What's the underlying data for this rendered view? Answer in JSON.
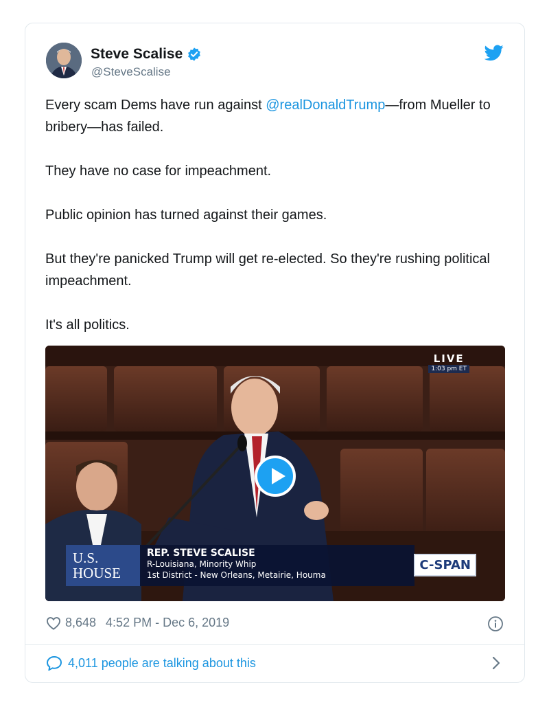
{
  "tweet": {
    "author_name": "Steve Scalise",
    "author_handle": "@SteveScalise",
    "paragraphs": [
      {
        "before": "Every scam Dems have run against ",
        "mention": "@realDonaldTrump",
        "after": "—from Mueller to bribery—has failed."
      },
      {
        "text": "They have no case for impeachment."
      },
      {
        "text": "Public opinion has turned against their games."
      },
      {
        "text": "But they're panicked Trump will get re-elected. So they're rushing political impeachment."
      },
      {
        "text": "It's all politics."
      }
    ],
    "likes": "8,648",
    "timestamp": "4:52 PM - Dec 6, 2019",
    "talking": "4,011 people are talking about this"
  },
  "video": {
    "live_label": "LIVE",
    "live_time": "1:03 pm ET",
    "house_logo_line1": "U.S.",
    "house_logo_line2": "HOUSE",
    "caption_name": "REP. STEVE SCALISE",
    "caption_line1": "R-Louisiana, Minority Whip",
    "caption_line2": "1st District - New Orleans, Metairie, Houma",
    "network": "C-SPAN"
  },
  "colors": {
    "link": "#1b95e0",
    "secondary_text": "#657786",
    "verified": "#1da1f2",
    "border": "#e1e8ed"
  },
  "icons": [
    "verified-badge-icon",
    "twitter-bird-icon",
    "play-icon",
    "heart-icon",
    "info-icon",
    "chat-bubble-icon",
    "chevron-right-icon"
  ]
}
